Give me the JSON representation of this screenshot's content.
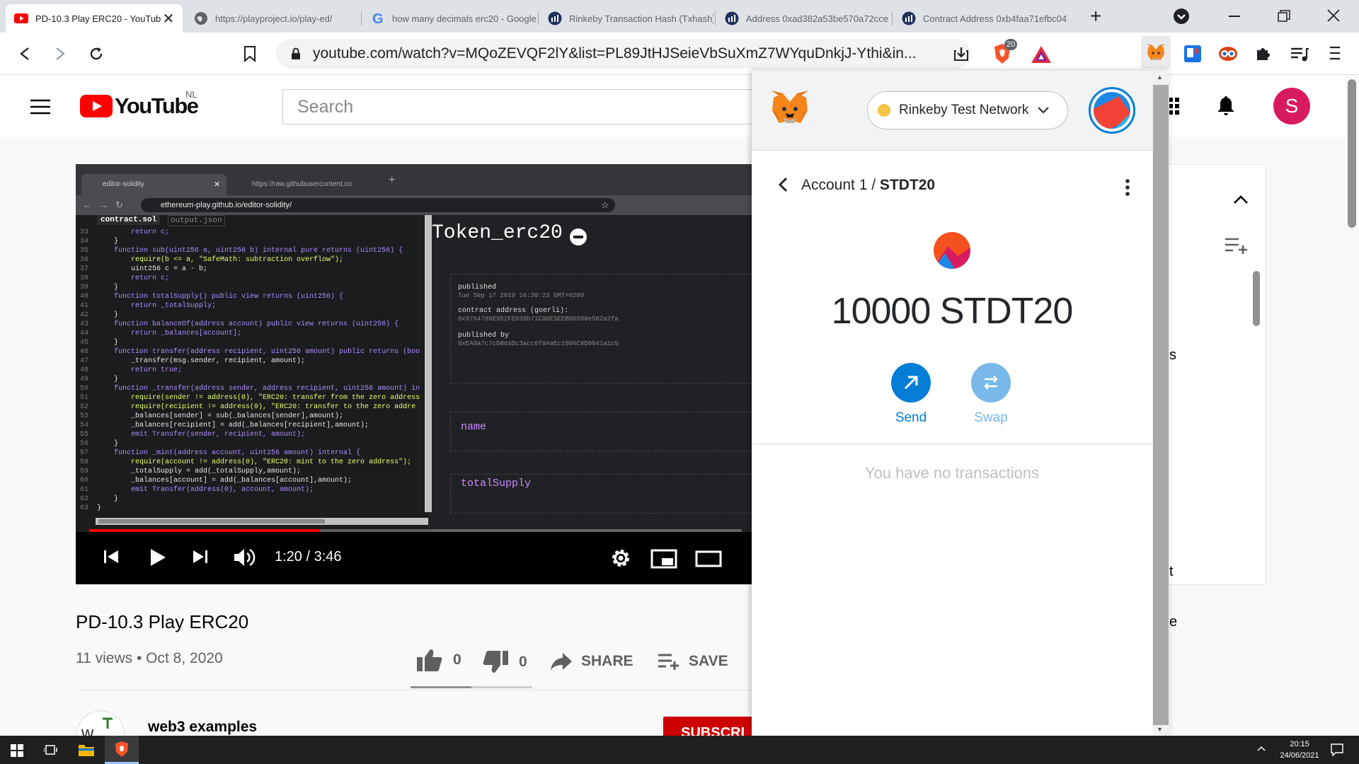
{
  "browser": {
    "tabs": [
      {
        "title": "PD-10.3 Play ERC20 - YouTube",
        "icon": "youtube-icon",
        "active": true
      },
      {
        "title": "https://playproject.io/play-ed/",
        "icon": "globe-icon"
      },
      {
        "title": "how many decimals erc20 - Google",
        "icon": "google-icon"
      },
      {
        "title": "Rinkeby Transaction Hash (Txhash)",
        "icon": "etherscan-icon"
      },
      {
        "title": "Address 0xad382a53be570a72cce",
        "icon": "etherscan-icon"
      },
      {
        "title": "Contract Address 0xb4faa71efbc04",
        "icon": "etherscan-icon"
      }
    ],
    "url": "youtube.com/watch?v=MQoZEVQF2lY&list=PL89JtHJSeieVbSuXmZ7WYquDnkjJ-Ythi&in...",
    "brave_badge": "20"
  },
  "youtube": {
    "brand": "YouTube",
    "region": "NL",
    "search_placeholder": "Search",
    "video": {
      "title": "PD-10.3 Play ERC20",
      "meta": "11 views • Oct 8, 2020",
      "likes": "0",
      "dislikes": "0",
      "share_label": "SHARE",
      "save_label": "SAVE",
      "time": "1:20 / 3:46",
      "progress": 0.354
    },
    "channel": {
      "name": "web3 examples"
    },
    "subscribe_label": "SUBSCRI",
    "side_fragments": [
      "s",
      "t",
      "e"
    ]
  },
  "embedded": {
    "tabs": [
      "editor-solidity",
      "https://raw.githubusercontent.co"
    ],
    "url": "ethereum-play.github.io/editor-solidity/",
    "files": [
      "contract.sol",
      "output.json"
    ],
    "code": [
      [
        "33",
        "        return c;"
      ],
      [
        "34",
        "    }"
      ],
      [
        "35",
        "    function sub(uint256 a, uint256 b) internal pure returns (uint256) {"
      ],
      [
        "36",
        "        require(b <= a, \"SafeMath: subtraction overflow\");"
      ],
      [
        "37",
        "        uint256 c = a - b;"
      ],
      [
        "38",
        "        return c;"
      ],
      [
        "39",
        "    }"
      ],
      [
        "40",
        "    function totalSupply() public view returns (uint256) {"
      ],
      [
        "41",
        "        return _totalSupply;"
      ],
      [
        "42",
        "    }"
      ],
      [
        "43",
        "    function balanceOf(address account) public view returns (uint256) {"
      ],
      [
        "44",
        "        return _balances[account];"
      ],
      [
        "45",
        "    }"
      ],
      [
        "46",
        "    function transfer(address recipient, uint256 amount) public returns (boo"
      ],
      [
        "47",
        "        _transfer(msg.sender, recipient, amount);"
      ],
      [
        "48",
        "        return true;"
      ],
      [
        "49",
        "    }"
      ],
      [
        "50",
        "    function _transfer(address sender, address recipient, uint256 amount) in"
      ],
      [
        "51",
        "        require(sender != address(0), \"ERC20: transfer from the zero address"
      ],
      [
        "52",
        "        require(recipient != address(0), \"ERC20: transfer to the zero addre"
      ],
      [
        "53",
        "        _balances[sender] = sub(_balances[sender],amount);"
      ],
      [
        "54",
        "        _balances[recipient] = add(_balances[recipient],amount);"
      ],
      [
        "55",
        "        emit Transfer(sender, recipient, amount);"
      ],
      [
        "56",
        "    }"
      ],
      [
        "57",
        "    function _mint(address account, uint256 amount) internal {"
      ],
      [
        "58",
        "        require(account != address(0), \"ERC20: mint to the zero address\");"
      ],
      [
        "59",
        "        _totalSupply = add(_totalSupply,amount);"
      ],
      [
        "60",
        "        _balances[account] = add(_balances[account],amount);"
      ],
      [
        "61",
        "        emit Transfer(address(0), account, amount);"
      ],
      [
        "62",
        "    }"
      ],
      [
        "63",
        "}"
      ]
    ],
    "panel_title": "Token_erc20",
    "published_label": "published",
    "published_date": "Tue Sep 17 2019 16:30:23 GMT+0200",
    "contract_label": "contract address (goerli):",
    "contract_address": "0x97A47d6E952FE030b71C86E5EEB06500e502a2fa",
    "publisher_label": "published by",
    "publisher_address": "0xEA9a7c7cD8d4Dc3acc6f0AaEc1506C8D6041a1c5",
    "field_name": "name",
    "field_total": "totalSupply"
  },
  "metamask": {
    "network": "Rinkeby Test Network",
    "breadcrumb_account": "Account 1",
    "breadcrumb_separator": " / ",
    "breadcrumb_token": "STDT20",
    "balance": "10000 STDT20",
    "send_label": "Send",
    "swap_label": "Swap",
    "empty_label": "You have no transactions",
    "colors": {
      "accent": "#037dd6",
      "swap": "#79b8e9",
      "network_dot": "#f6c343"
    }
  },
  "taskbar": {
    "time": "20:15",
    "date": "24/06/2021"
  }
}
